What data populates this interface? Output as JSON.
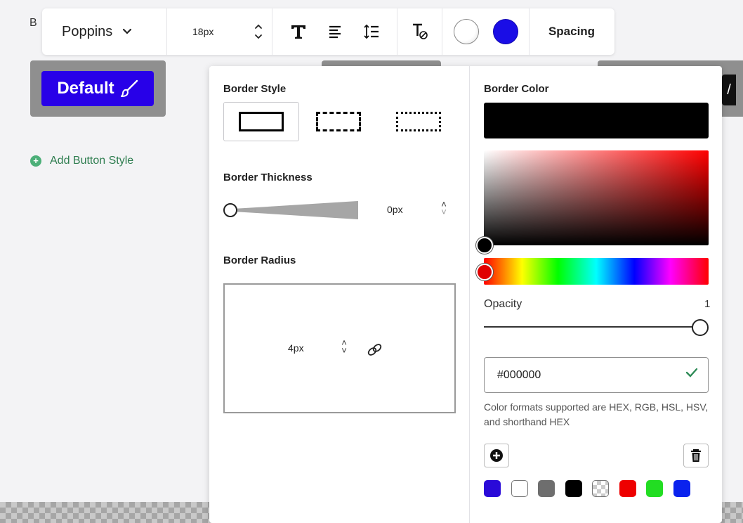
{
  "background": {
    "heading_letter": "B",
    "default_button_label": "Default",
    "add_style_label": "Add Button Style"
  },
  "toolbar": {
    "font_family": "Poppins",
    "font_size": "18px",
    "spacing_label": "Spacing",
    "text_color": "#ffffff",
    "background_color": "#1a0de6"
  },
  "panel": {
    "border_style": {
      "label": "Border Style",
      "options": [
        "solid",
        "dashed",
        "dotted"
      ],
      "selected": "solid"
    },
    "border_thickness": {
      "label": "Border Thickness",
      "value": "0px"
    },
    "border_radius": {
      "label": "Border Radius",
      "value": "4px"
    },
    "border_color": {
      "label": "Border Color",
      "current": "#000000",
      "opacity_label": "Opacity",
      "opacity_value": "1",
      "hex_value": "#000000",
      "hint": "Color formats supported are HEX, RGB, HSL, HSV, and shorthand HEX",
      "presets": [
        "#2a0ad8",
        "#ffffff",
        "#6e6e6e",
        "#000000",
        "transparent",
        "#ee0000",
        "#22dd22",
        "#0a22ee"
      ]
    }
  }
}
